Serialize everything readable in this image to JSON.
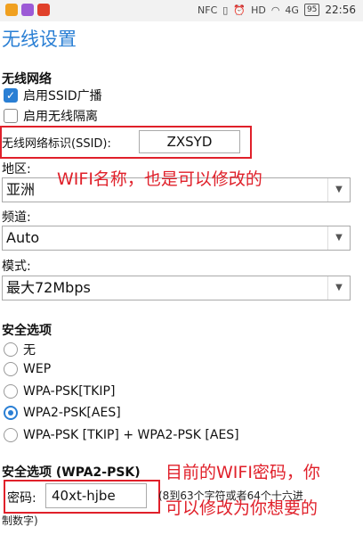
{
  "status_bar": {
    "time": "22:56",
    "battery": "95",
    "signal": "4G",
    "nfc": "NFC",
    "hd": "HD",
    "icons": [
      "app-icon-1",
      "app-icon-2",
      "app-icon-3",
      "nfc-icon",
      "vibrate-icon",
      "alarm-icon",
      "hd-icon",
      "wifi-icon",
      "signal-icon",
      "battery-icon"
    ]
  },
  "page": {
    "title": "无线设置"
  },
  "wireless": {
    "section_title": "无线网络",
    "ssid_broadcast": {
      "label": "启用SSID广播",
      "checked": true
    },
    "isolation": {
      "label": "启用无线隔离",
      "checked": false
    },
    "ssid_label": "无线网络标识(SSID):",
    "ssid_value": "ZXSYD",
    "region_label": "地区:",
    "region_value": "亚洲",
    "channel_label": "频道:",
    "channel_value": "Auto",
    "mode_label": "模式:",
    "mode_value": "最大72Mbps"
  },
  "security": {
    "section_title": "安全选项",
    "options": [
      {
        "label": "无",
        "selected": false
      },
      {
        "label": "WEP",
        "selected": false
      },
      {
        "label": "WPA-PSK[TKIP]",
        "selected": false
      },
      {
        "label": "WPA2-PSK[AES]",
        "selected": true
      },
      {
        "label": "WPA-PSK [TKIP] + WPA2-PSK [AES]",
        "selected": false
      }
    ],
    "sub_title": "安全选项 (WPA2-PSK)",
    "password_label": "密码:",
    "password_value": "40xt-hjbe",
    "hint_line1": "(8到63个字符或者64个十六进",
    "hint_line2": "制数字)"
  },
  "annotations": {
    "wifi_name": "WIFI名称，也是可以修改的",
    "password_line1": "目前的WIFI密码，你",
    "password_line2": "可以修改为你想要的"
  },
  "colors": {
    "accent": "#2a7fd4",
    "annotation": "#e0202a"
  }
}
